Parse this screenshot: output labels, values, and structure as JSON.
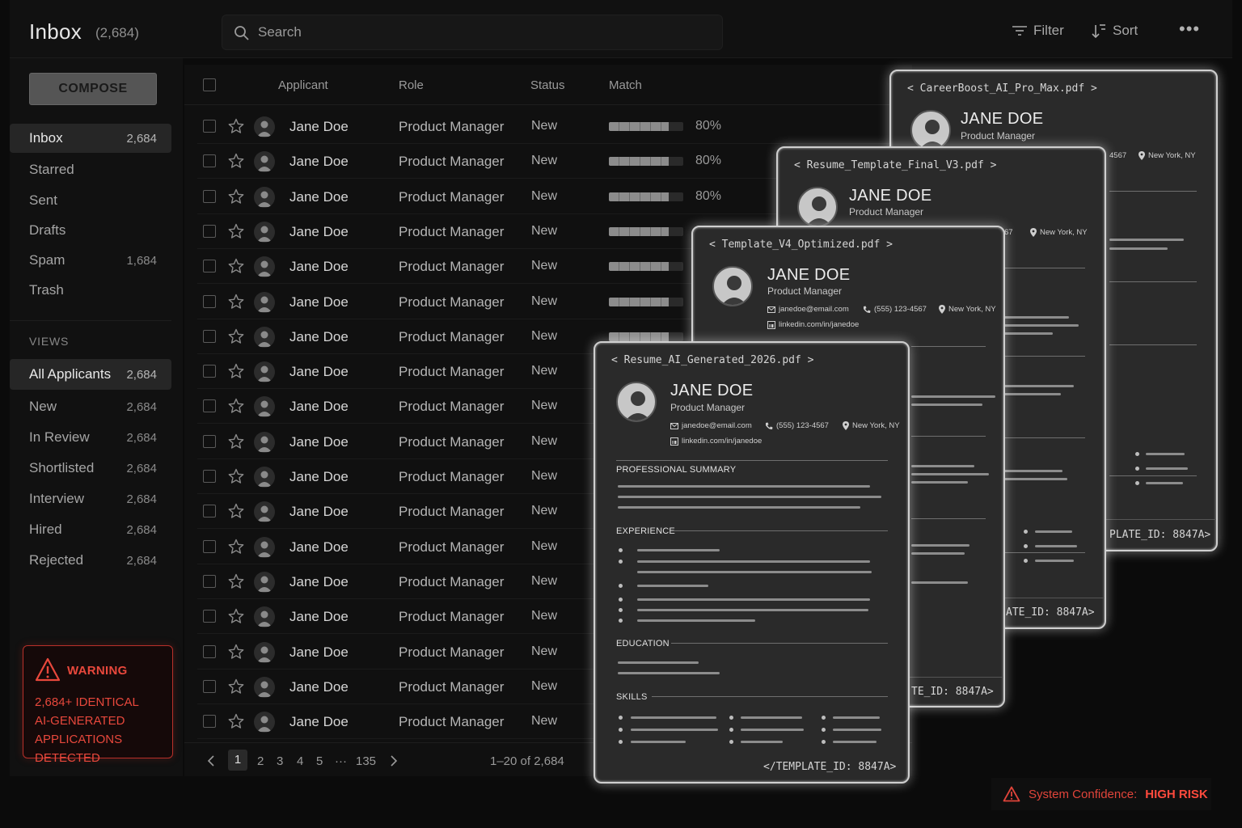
{
  "header": {
    "title": "Inbox",
    "count": "(2,684)",
    "search_placeholder": "Search",
    "filter_label": "Filter",
    "sort_label": "Sort"
  },
  "sidebar": {
    "compose_label": "COMPOSE",
    "mailboxes": [
      {
        "label": "Inbox",
        "count": "2,684"
      },
      {
        "label": "Starred",
        "count": ""
      },
      {
        "label": "Sent",
        "count": ""
      },
      {
        "label": "Drafts",
        "count": ""
      },
      {
        "label": "Spam",
        "count": "1,684"
      },
      {
        "label": "Trash",
        "count": ""
      }
    ],
    "views_title": "VIEWS",
    "views": [
      {
        "label": "All Applicants",
        "count": "2,684"
      },
      {
        "label": "New",
        "count": "2,684"
      },
      {
        "label": "In Review",
        "count": "2,684"
      },
      {
        "label": "Shortlisted",
        "count": "2,684"
      },
      {
        "label": "Interview",
        "count": "2,684"
      },
      {
        "label": "Hired",
        "count": "2,684"
      },
      {
        "label": "Rejected",
        "count": "2,684"
      }
    ],
    "warning": {
      "title": "WARNING",
      "lines": [
        "2,684+ IDENTICAL",
        "AI-GENERATED",
        "APPLICATIONS DETECTED"
      ]
    }
  },
  "table": {
    "columns": [
      "Applicant",
      "Role",
      "Status",
      "Match"
    ],
    "rows": [
      {
        "name": "Jane Doe",
        "role": "Product Manager",
        "status": "New",
        "match": 0.8,
        "match_label": "80%"
      },
      {
        "name": "Jane Doe",
        "role": "Product Manager",
        "status": "New",
        "match": 0.8,
        "match_label": "80%"
      },
      {
        "name": "Jane Doe",
        "role": "Product Manager",
        "status": "New",
        "match": 0.8,
        "match_label": "80%"
      },
      {
        "name": "Jane Doe",
        "role": "Product Manager",
        "status": "New",
        "match": 0.8,
        "match_label": ""
      },
      {
        "name": "Jane Doe",
        "role": "Product Manager",
        "status": "New",
        "match": 0.8,
        "match_label": ""
      },
      {
        "name": "Jane Doe",
        "role": "Product Manager",
        "status": "New",
        "match": 0.8,
        "match_label": ""
      },
      {
        "name": "Jane Doe",
        "role": "Product Manager",
        "status": "New",
        "match": 0.8,
        "match_label": ""
      },
      {
        "name": "Jane Doe",
        "role": "Product Manager",
        "status": "New",
        "match": 0.8,
        "match_label": ""
      },
      {
        "name": "Jane Doe",
        "role": "Product Manager",
        "status": "New",
        "match": 0.8,
        "match_label": ""
      },
      {
        "name": "Jane Doe",
        "role": "Product Manager",
        "status": "New",
        "match": 0.8,
        "match_label": ""
      },
      {
        "name": "Jane Doe",
        "role": "Product Manager",
        "status": "New",
        "match": 0.8,
        "match_label": ""
      },
      {
        "name": "Jane Doe",
        "role": "Product Manager",
        "status": "New",
        "match": 0.8,
        "match_label": ""
      },
      {
        "name": "Jane Doe",
        "role": "Product Manager",
        "status": "New",
        "match": 0.8,
        "match_label": ""
      },
      {
        "name": "Jane Doe",
        "role": "Product Manager",
        "status": "New",
        "match": 0.8,
        "match_label": ""
      },
      {
        "name": "Jane Doe",
        "role": "Product Manager",
        "status": "New",
        "match": 0.8,
        "match_label": ""
      },
      {
        "name": "Jane Doe",
        "role": "Product Manager",
        "status": "New",
        "match": 0.8,
        "match_label": ""
      },
      {
        "name": "Jane Doe",
        "role": "Product Manager",
        "status": "New",
        "match": 0.8,
        "match_label": ""
      },
      {
        "name": "Jane Doe",
        "role": "Product Manager",
        "status": "New",
        "match": 0.8,
        "match_label": ""
      }
    ]
  },
  "pagination": {
    "pages": [
      "1",
      "2",
      "3",
      "4",
      "5",
      "···",
      "135"
    ],
    "current": "1",
    "range": "1–20 of 2,684"
  },
  "resumes": [
    {
      "filename": "< CareerBoost_AI_Pro_Max.pdf >",
      "name": "JANE DOE",
      "role": "Product Manager",
      "phone_fragment": "4567",
      "location": "New York, NY",
      "template_id": "PLATE_ID: 8847A>"
    },
    {
      "filename": "< Resume_Template_Final_V3.pdf >",
      "name": "JANE DOE",
      "role": "Product Manager",
      "phone_fragment": "67",
      "location": "New York, NY",
      "template_id": "ATE_ID: 8847A>"
    },
    {
      "filename": "< Template_V4_Optimized.pdf >",
      "name": "JANE DOE",
      "role": "Product Manager",
      "email": "janedoe@email.com",
      "phone": "(555) 123-4567",
      "location": "New York, NY",
      "linkedin": "linkedin.com/in/janedoe",
      "template_id": "TE_ID: 8847A>"
    },
    {
      "filename": "< Resume_AI_Generated_2026.pdf >",
      "name": "JANE DOE",
      "role": "Product Manager",
      "email": "janedoe@email.com",
      "phone": "(555) 123-4567",
      "location": "New York, NY",
      "linkedin": "linkedin.com/in/janedoe",
      "sections": [
        "PROFESSIONAL SUMMARY",
        "EXPERIENCE",
        "EDUCATION",
        "SKILLS"
      ],
      "template_id": "</TEMPLATE_ID: 8847A>"
    }
  ],
  "system_confidence": {
    "label": "System Confidence:",
    "value": "HIGH RISK"
  },
  "colors": {
    "alert": "#e8483c",
    "background": "#0b0b0b",
    "panel": "#111111"
  }
}
